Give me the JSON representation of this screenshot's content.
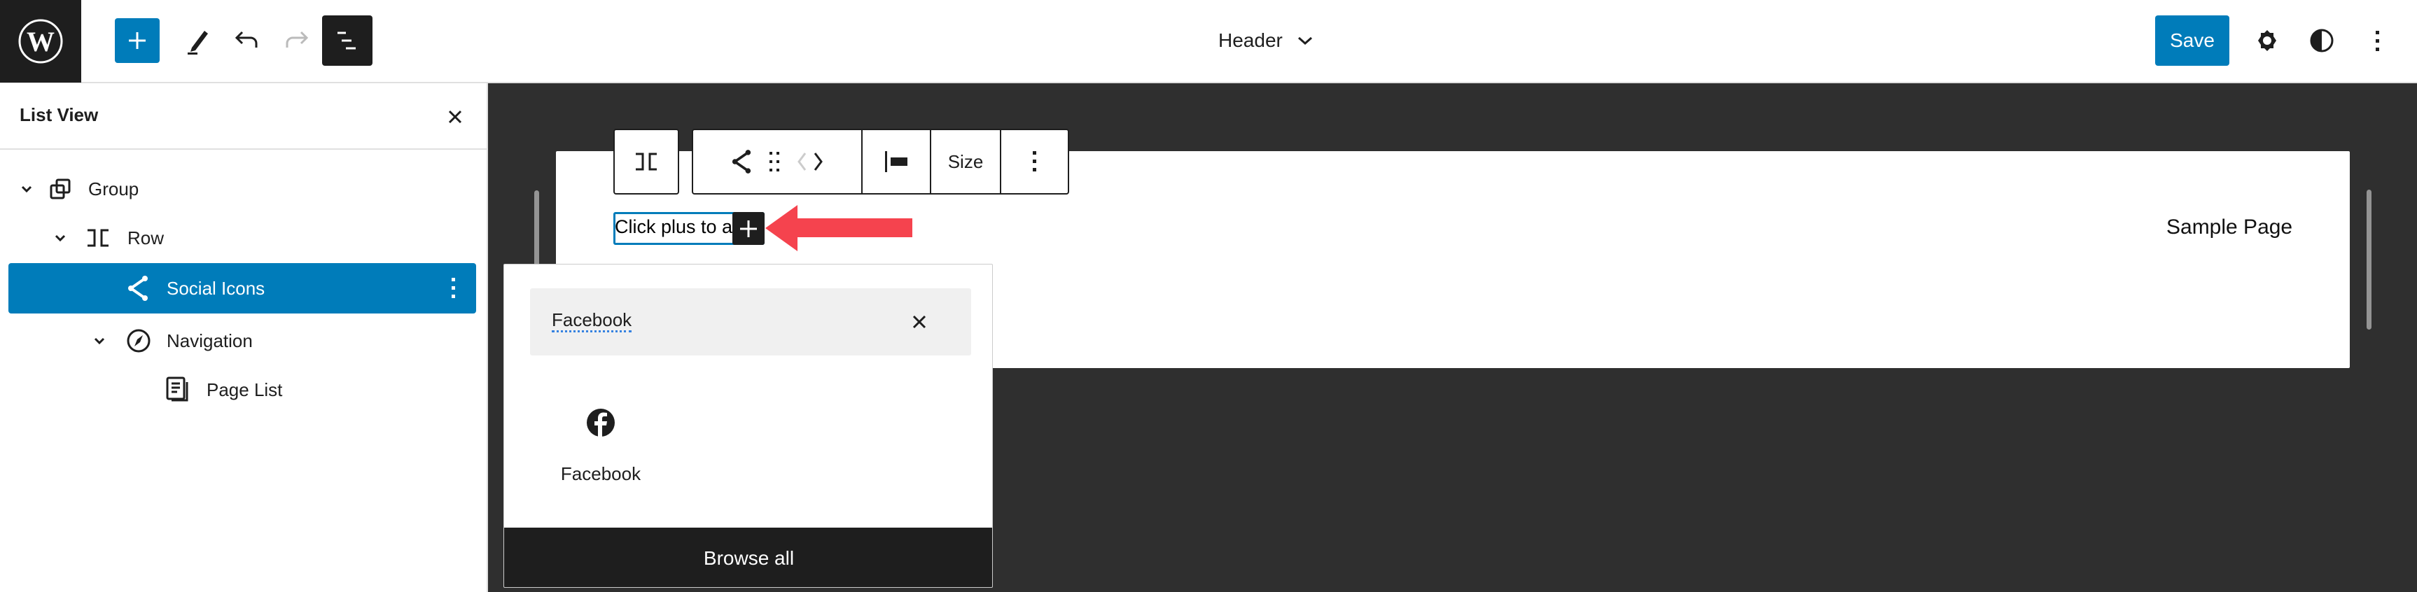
{
  "header": {
    "add_block_label": "Add block",
    "tools_label": "Tools",
    "undo_label": "Undo",
    "redo_label": "Redo",
    "list_view_label": "List View",
    "document_title": "Header",
    "save_label": "Save",
    "settings_label": "Settings",
    "styles_label": "Styles",
    "options_label": "Options"
  },
  "sidebar": {
    "title": "List View",
    "close_label": "Close",
    "items": [
      {
        "label": "Group",
        "icon": "group-icon",
        "expandable": true,
        "selected": false
      },
      {
        "label": "Row",
        "icon": "row-icon",
        "expandable": true,
        "selected": false
      },
      {
        "label": "Social Icons",
        "icon": "share-icon",
        "expandable": false,
        "selected": true
      },
      {
        "label": "Navigation",
        "icon": "navigation-compass-icon",
        "expandable": true,
        "selected": false
      },
      {
        "label": "Page List",
        "icon": "page-list-icon",
        "expandable": false,
        "selected": false
      }
    ]
  },
  "block_toolbar": {
    "parent_label": "Select Row",
    "block_type_label": "Social Icons",
    "drag_label": "Drag",
    "move_left_label": "Move left",
    "move_right_label": "Move right",
    "justify_label": "Change items justification",
    "size_label": "Size",
    "options_label": "Options"
  },
  "canvas": {
    "social_placeholder_text": "Click plus to a",
    "nav_item": "Sample Page"
  },
  "inserter": {
    "search_value": "Facebook",
    "clear_label": "Clear search",
    "results": [
      {
        "label": "Facebook",
        "icon": "facebook-icon"
      }
    ],
    "browse_all_label": "Browse all"
  },
  "colors": {
    "accent": "#007cba",
    "dark": "#1e1e1e",
    "canvas_bg": "#2f2f2f",
    "annotation_arrow": "#f5434e"
  }
}
